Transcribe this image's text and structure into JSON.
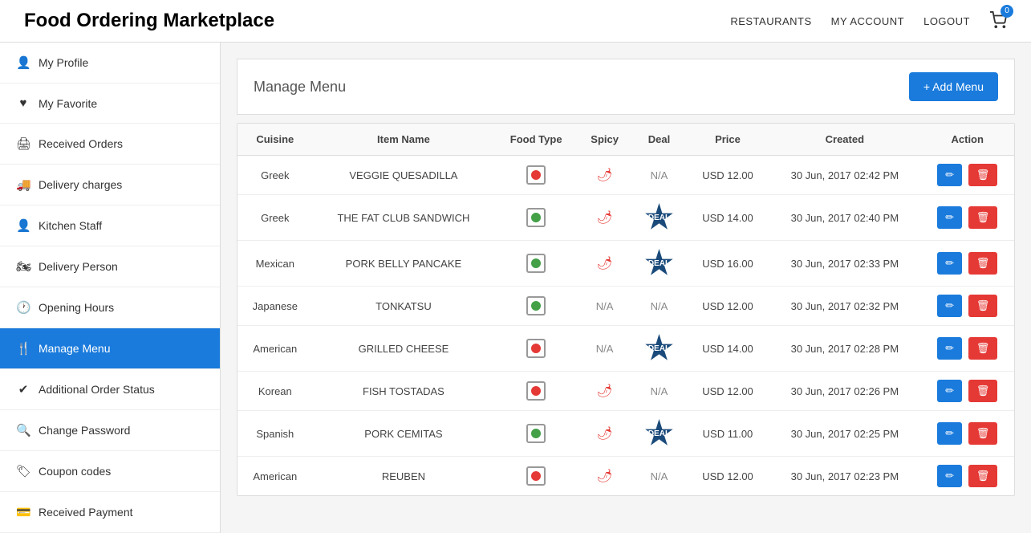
{
  "header": {
    "logo": "Food Ordering Marketplace",
    "nav": [
      {
        "label": "RESTAURANTS",
        "id": "nav-restaurants"
      },
      {
        "label": "MY ACCOUNT",
        "id": "nav-my-account"
      },
      {
        "label": "LOGOUT",
        "id": "nav-logout"
      }
    ],
    "cart_count": "0"
  },
  "sidebar": {
    "items": [
      {
        "id": "my-profile",
        "label": "My Profile",
        "icon": "👤",
        "active": false
      },
      {
        "id": "my-favorite",
        "label": "My Favorite",
        "icon": "♥",
        "active": false
      },
      {
        "id": "received-orders",
        "label": "Received Orders",
        "icon": "🖨",
        "active": false
      },
      {
        "id": "delivery-charges",
        "label": "Delivery charges",
        "icon": "🚚",
        "active": false
      },
      {
        "id": "kitchen-staff",
        "label": "Kitchen Staff",
        "icon": "👤",
        "active": false
      },
      {
        "id": "delivery-person",
        "label": "Delivery Person",
        "icon": "🏍",
        "active": false
      },
      {
        "id": "opening-hours",
        "label": "Opening Hours",
        "icon": "🕐",
        "active": false
      },
      {
        "id": "manage-menu",
        "label": "Manage Menu",
        "icon": "🍴",
        "active": true
      },
      {
        "id": "additional-order-status",
        "label": "Additional Order Status",
        "icon": "✔",
        "active": false
      },
      {
        "id": "change-password",
        "label": "Change Password",
        "icon": "🔍",
        "active": false
      },
      {
        "id": "coupon-codes",
        "label": "Coupon codes",
        "icon": "🏷",
        "active": false
      },
      {
        "id": "received-payment",
        "label": "Received Payment",
        "icon": "💳",
        "active": false
      }
    ]
  },
  "main": {
    "title": "Manage Menu",
    "add_button_label": "+ Add Menu",
    "table": {
      "columns": [
        "Cuisine",
        "Item Name",
        "Food Type",
        "Spicy",
        "Deal",
        "Price",
        "Created",
        "Action"
      ],
      "rows": [
        {
          "cuisine": "Greek",
          "item_name": "VEGGIE QUESADILLA",
          "food_type": "red",
          "spicy": true,
          "deal": false,
          "price": "USD 12.00",
          "created": "30 Jun, 2017 02:42 PM"
        },
        {
          "cuisine": "Greek",
          "item_name": "THE FAT CLUB SANDWICH",
          "food_type": "green",
          "spicy": true,
          "deal": true,
          "price": "USD 14.00",
          "created": "30 Jun, 2017 02:40 PM"
        },
        {
          "cuisine": "Mexican",
          "item_name": "PORK BELLY PANCAKE",
          "food_type": "green",
          "spicy": true,
          "deal": true,
          "price": "USD 16.00",
          "created": "30 Jun, 2017 02:33 PM"
        },
        {
          "cuisine": "Japanese",
          "item_name": "TONKATSU",
          "food_type": "green",
          "spicy": false,
          "deal": false,
          "price": "USD 12.00",
          "created": "30 Jun, 2017 02:32 PM"
        },
        {
          "cuisine": "American",
          "item_name": "GRILLED CHEESE",
          "food_type": "red",
          "spicy": false,
          "deal": true,
          "price": "USD 14.00",
          "created": "30 Jun, 2017 02:28 PM"
        },
        {
          "cuisine": "Korean",
          "item_name": "FISH TOSTADAS",
          "food_type": "red",
          "spicy": true,
          "deal": false,
          "price": "USD 12.00",
          "created": "30 Jun, 2017 02:26 PM"
        },
        {
          "cuisine": "Spanish",
          "item_name": "PORK CEMITAS",
          "food_type": "green",
          "spicy": true,
          "deal": true,
          "price": "USD 11.00",
          "created": "30 Jun, 2017 02:25 PM"
        },
        {
          "cuisine": "American",
          "item_name": "REUBEN",
          "food_type": "red",
          "spicy": true,
          "deal": false,
          "price": "USD 12.00",
          "created": "30 Jun, 2017 02:23 PM"
        }
      ]
    }
  }
}
